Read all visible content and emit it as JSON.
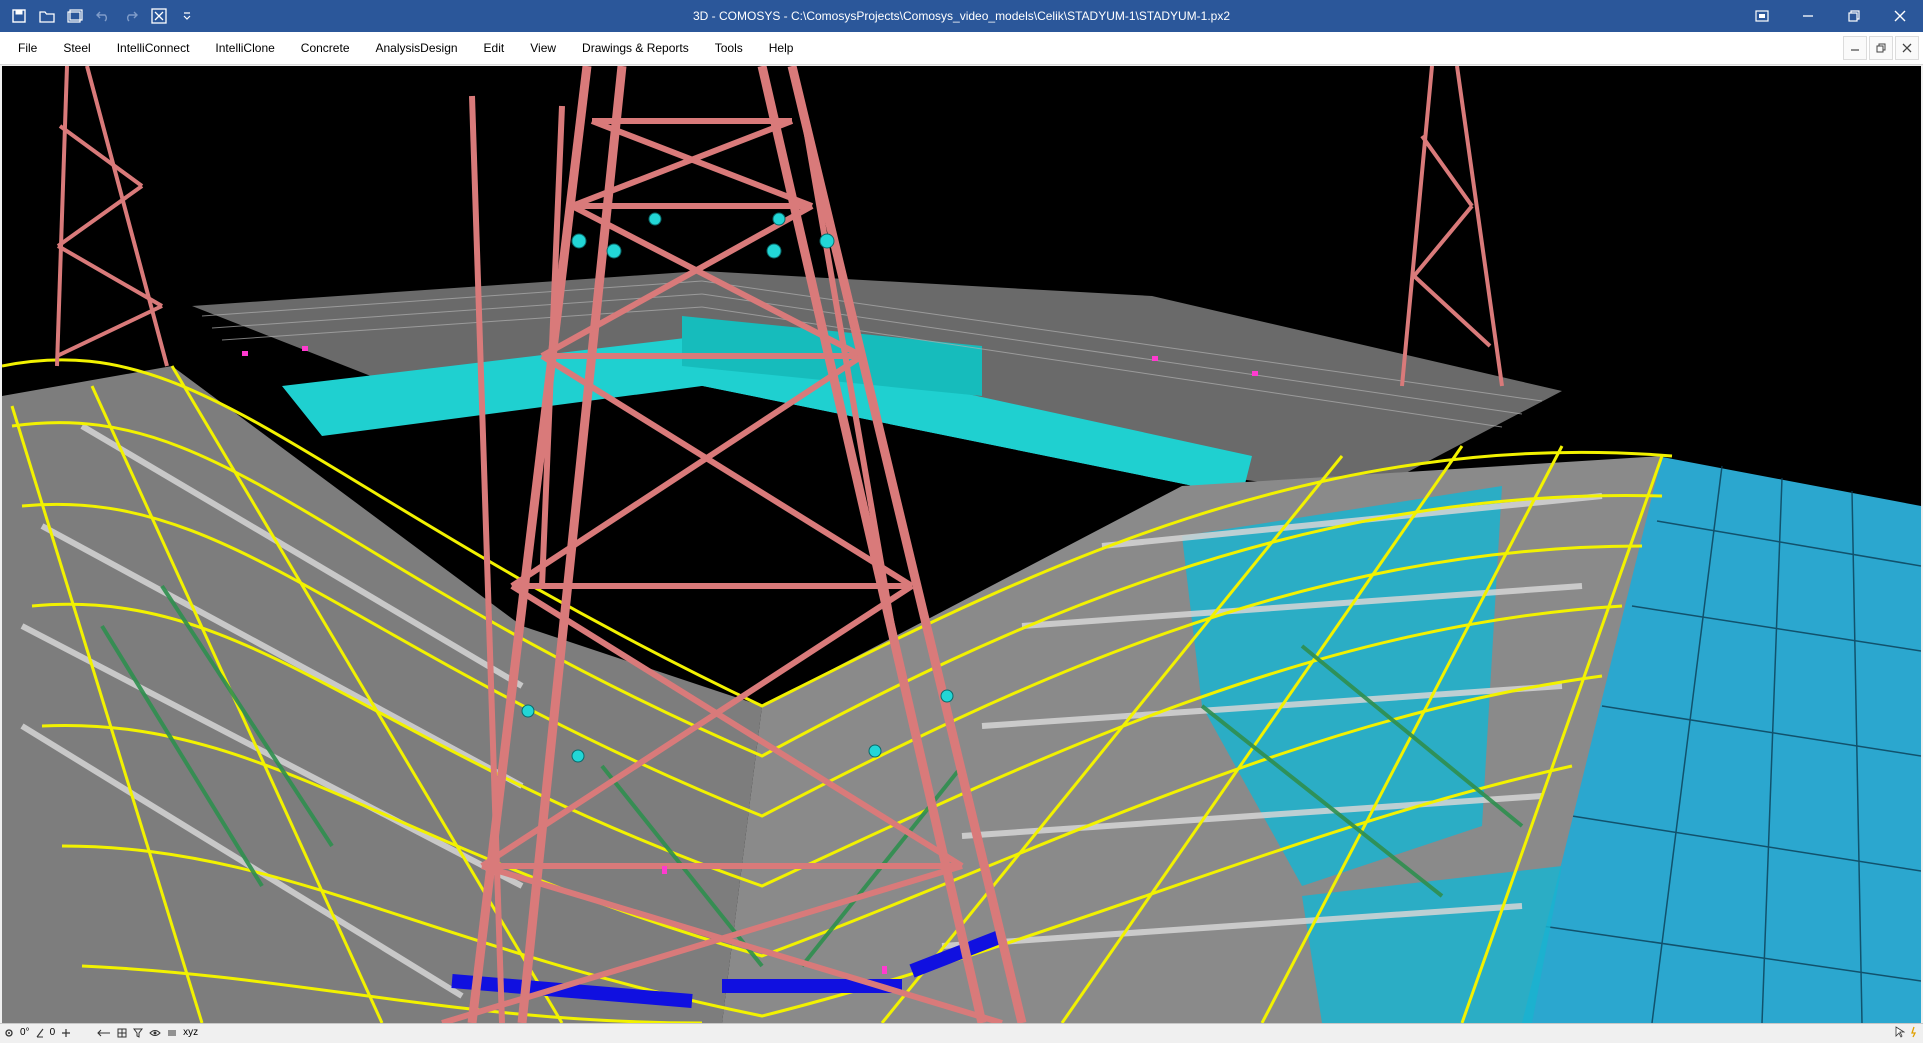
{
  "window": {
    "title": "3D - COMOSYS - C:\\ComosysProjects\\Comosys_video_models\\Celik\\STADYUM-1\\STADYUM-1.px2"
  },
  "menu": {
    "items": [
      "File",
      "Steel",
      "IntelliConnect",
      "IntelliClone",
      "Concrete",
      "AnalysisDesign",
      "Edit",
      "View",
      "Drawings & Reports",
      "Tools",
      "Help"
    ]
  },
  "statusbar": {
    "angle1": "0°",
    "angle2": "0",
    "axis_label": "xyz"
  },
  "colors": {
    "titlebar": "#2b579a",
    "viewport_bg": "#000000",
    "truss": "#d97a7a",
    "beams_yellow": "#f2f200",
    "seating_cyan": "#17c7c7",
    "roof_blue": "#2ba7cf",
    "bracing_green": "#2f8f4f",
    "deck_gray": "#8c8c8c",
    "highlight_blue": "#1010e0"
  }
}
